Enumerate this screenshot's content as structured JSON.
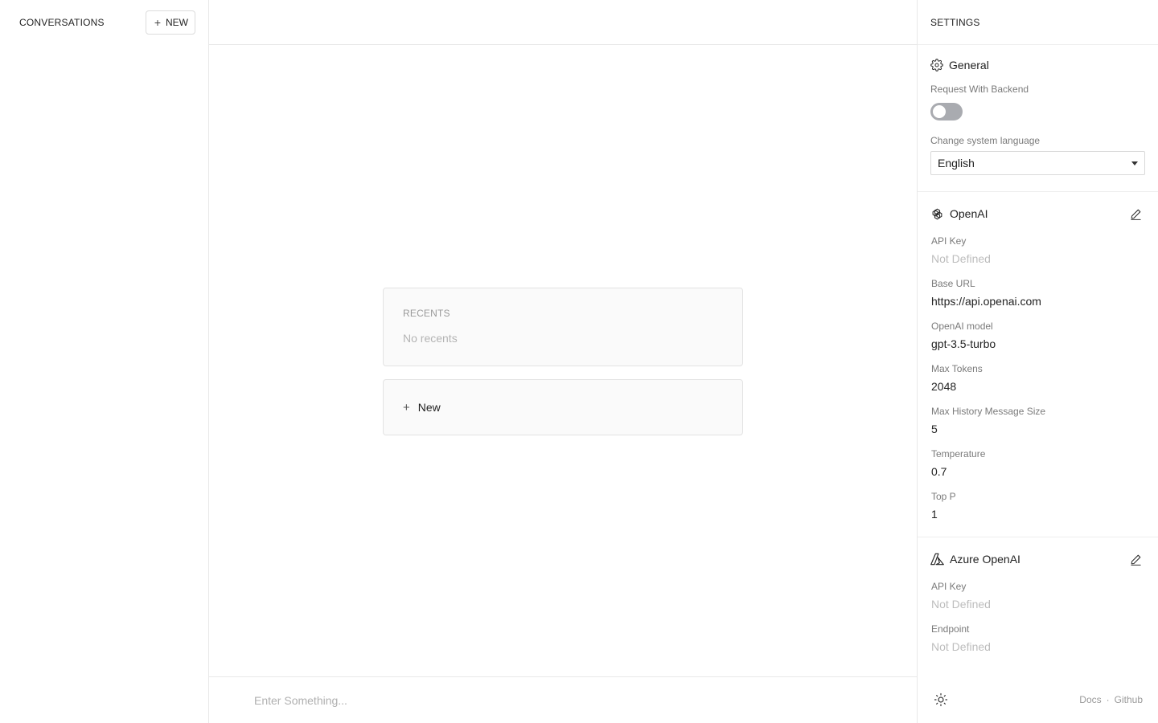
{
  "sidebar": {
    "title": "CONVERSATIONS",
    "new_button_label": "NEW"
  },
  "main": {
    "recents": {
      "title": "RECENTS",
      "empty_text": "No recents"
    },
    "new_card_label": "New",
    "input_placeholder": "Enter Something..."
  },
  "settings": {
    "title": "SETTINGS",
    "general": {
      "title": "General",
      "request_backend_label": "Request With Backend",
      "request_backend_on": false,
      "language_label": "Change system language",
      "language_value": "English"
    },
    "openai": {
      "title": "OpenAI",
      "fields": [
        {
          "label": "API Key",
          "value": "Not Defined",
          "muted": true
        },
        {
          "label": "Base URL",
          "value": "https://api.openai.com",
          "muted": false
        },
        {
          "label": "OpenAI model",
          "value": "gpt-3.5-turbo",
          "muted": false
        },
        {
          "label": "Max Tokens",
          "value": "2048",
          "muted": false
        },
        {
          "label": "Max History Message Size",
          "value": "5",
          "muted": false
        },
        {
          "label": "Temperature",
          "value": "0.7",
          "muted": false
        },
        {
          "label": "Top P",
          "value": "1",
          "muted": false
        }
      ]
    },
    "azure": {
      "title": "Azure OpenAI",
      "fields": [
        {
          "label": "API Key",
          "value": "Not Defined",
          "muted": true
        },
        {
          "label": "Endpoint",
          "value": "Not Defined",
          "muted": true
        }
      ]
    },
    "footer": {
      "docs_label": "Docs",
      "separator": "·",
      "github_label": "Github"
    }
  },
  "icons": {
    "plus": "+",
    "gear": "gear-icon",
    "openai": "openai-icon",
    "azure": "azure-icon",
    "edit": "edit-icon",
    "sun": "sun-icon"
  }
}
